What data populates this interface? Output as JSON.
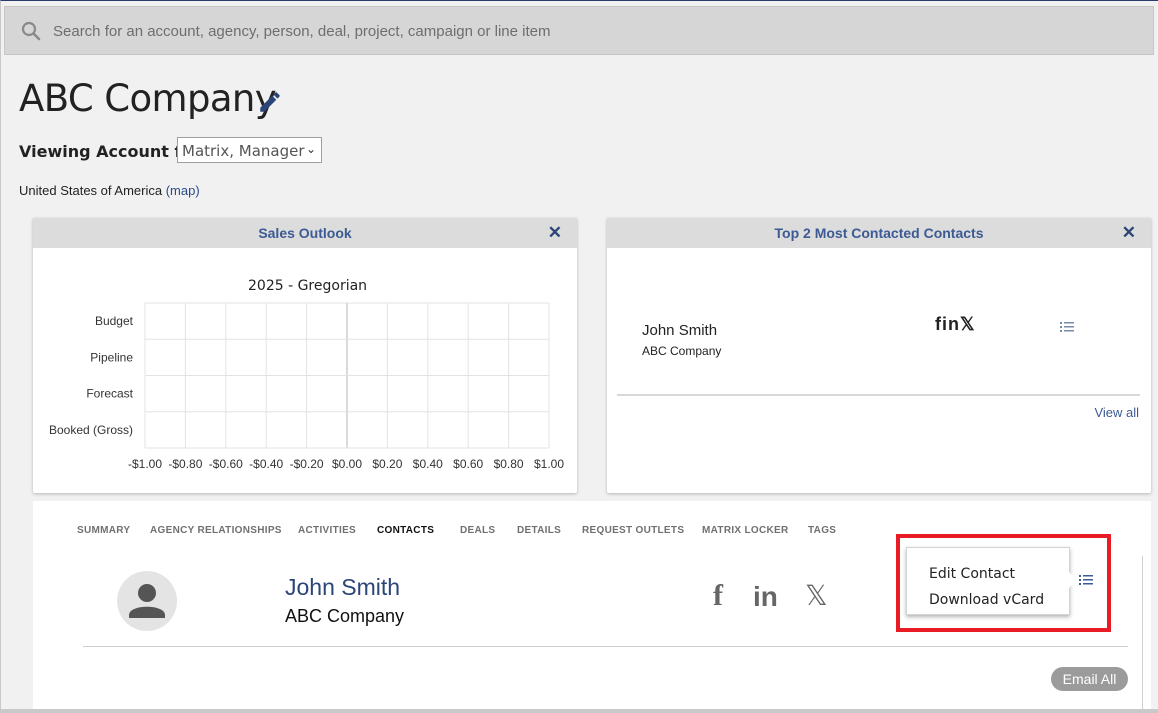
{
  "search": {
    "placeholder": "Search for an account, agency, person, deal, project, campaign or line item",
    "icon": "search-icon"
  },
  "account": {
    "title": "ABC Company",
    "edit_icon": "pencil-icon",
    "viewing_label": "Viewing Account for:",
    "viewing_value": "Matrix, Manager",
    "country": "United States of America",
    "map_link": "(map)"
  },
  "sales_outlook": {
    "header": "Sales Outlook",
    "close_icon": "close-icon"
  },
  "chart_data": {
    "type": "bar",
    "orientation": "horizontal",
    "title": "2025 - Gregorian",
    "categories": [
      "Budget",
      "Pipeline",
      "Forecast",
      "Booked (Gross)"
    ],
    "values": [
      0,
      0,
      0,
      0
    ],
    "xlim": [
      -1.0,
      1.0
    ],
    "xticks": [
      "-$1.00",
      "-$0.80",
      "-$0.60",
      "-$0.40",
      "-$0.20",
      "$0.00",
      "$0.20",
      "$0.40",
      "$0.60",
      "$0.80",
      "$1.00"
    ],
    "grid": true
  },
  "top_contacts": {
    "header": "Top 2 Most Contacted Contacts",
    "close_icon": "close-icon",
    "contact": {
      "name": "John Smith",
      "company": "ABC Company"
    },
    "social": "fin𝕏",
    "view_all": "View all"
  },
  "tabs": [
    {
      "label": "SUMMARY",
      "active": false
    },
    {
      "label": "AGENCY RELATIONSHIPS",
      "active": false
    },
    {
      "label": "ACTIVITIES",
      "active": false
    },
    {
      "label": "CONTACTS",
      "active": true
    },
    {
      "label": "DEALS",
      "active": false
    },
    {
      "label": "DETAILS",
      "active": false
    },
    {
      "label": "REQUEST OUTLETS",
      "active": false
    },
    {
      "label": "MATRIX LOCKER",
      "active": false
    },
    {
      "label": "TAGS",
      "active": false
    }
  ],
  "contact": {
    "name": "John Smith",
    "company": "ABC Company",
    "facebook": "f",
    "linkedin": "in",
    "x": "𝕏"
  },
  "menu": {
    "edit": "Edit Contact",
    "download": "Download vCard"
  },
  "email_all": "Email All",
  "colors": {
    "highlight": "#e81c24",
    "link": "#2c4577",
    "header_bg": "#dcdcdc"
  }
}
